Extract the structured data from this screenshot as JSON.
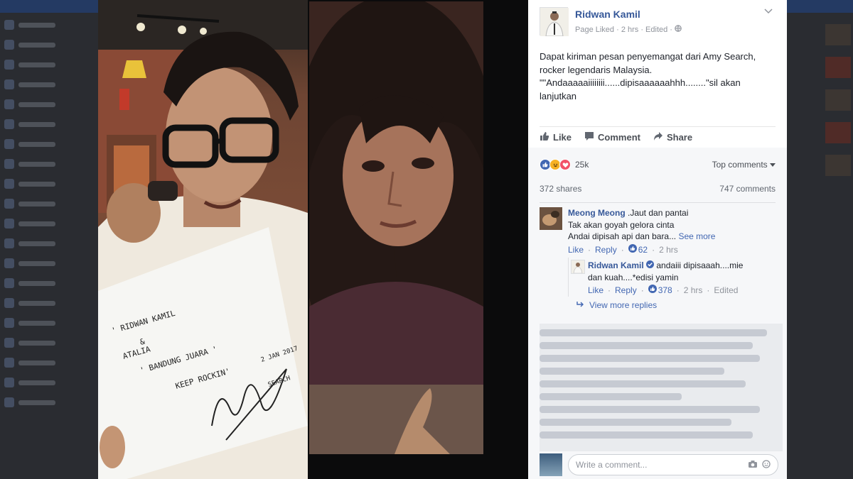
{
  "post": {
    "author": "Ridwan Kamil",
    "meta": "Page Liked · 2 hrs · Edited · ",
    "body": "Dapat kiriman pesan penyemangat dari Amy Search, rocker legendaris Malaysia. \"\"Andaaaaaiiiiiiii......dipisaaaaaahhh........\"sil akan lanjutkan",
    "like_label": "Like",
    "comment_label": "Comment",
    "share_label": "Share",
    "reaction_count": "25k",
    "top_comments_label": "Top comments",
    "shares": "372 shares",
    "comments": "747 comments",
    "colors": {
      "link": "#365899",
      "like_blue": "#4267b2",
      "love_red": "#f25268",
      "haha_yellow": "#f7b125"
    }
  },
  "comments": [
    {
      "name": "Meong Meong",
      "lines": [
        ".Jaut dan pantai",
        "Tak akan goyah gelora cinta",
        "Andai dipisah api dan bara..."
      ],
      "see_more": "See more",
      "like": "Like",
      "reply": "Reply",
      "likes": "62",
      "time": "2 hrs"
    }
  ],
  "reply": {
    "name": "Ridwan Kamil",
    "text_line1": "andaiii dipisaaah....mie",
    "text_line2": "dan kuah....*edisi yamin",
    "like": "Like",
    "reply": "Reply",
    "likes": "378",
    "time": "2 hrs",
    "edited": "Edited"
  },
  "view_more_replies": "View more replies",
  "compose_placeholder": "Write a comment...",
  "photo_left_note": {
    "line1": "' RIDWAN KAMIL",
    "line2": "&",
    "line3": "ATALIA",
    "line4": "' BANDUNG JUARA '",
    "line5": "KEEP ROCKIN'",
    "date": "2 JAN 2017",
    "sig_name": "SEARCH"
  }
}
